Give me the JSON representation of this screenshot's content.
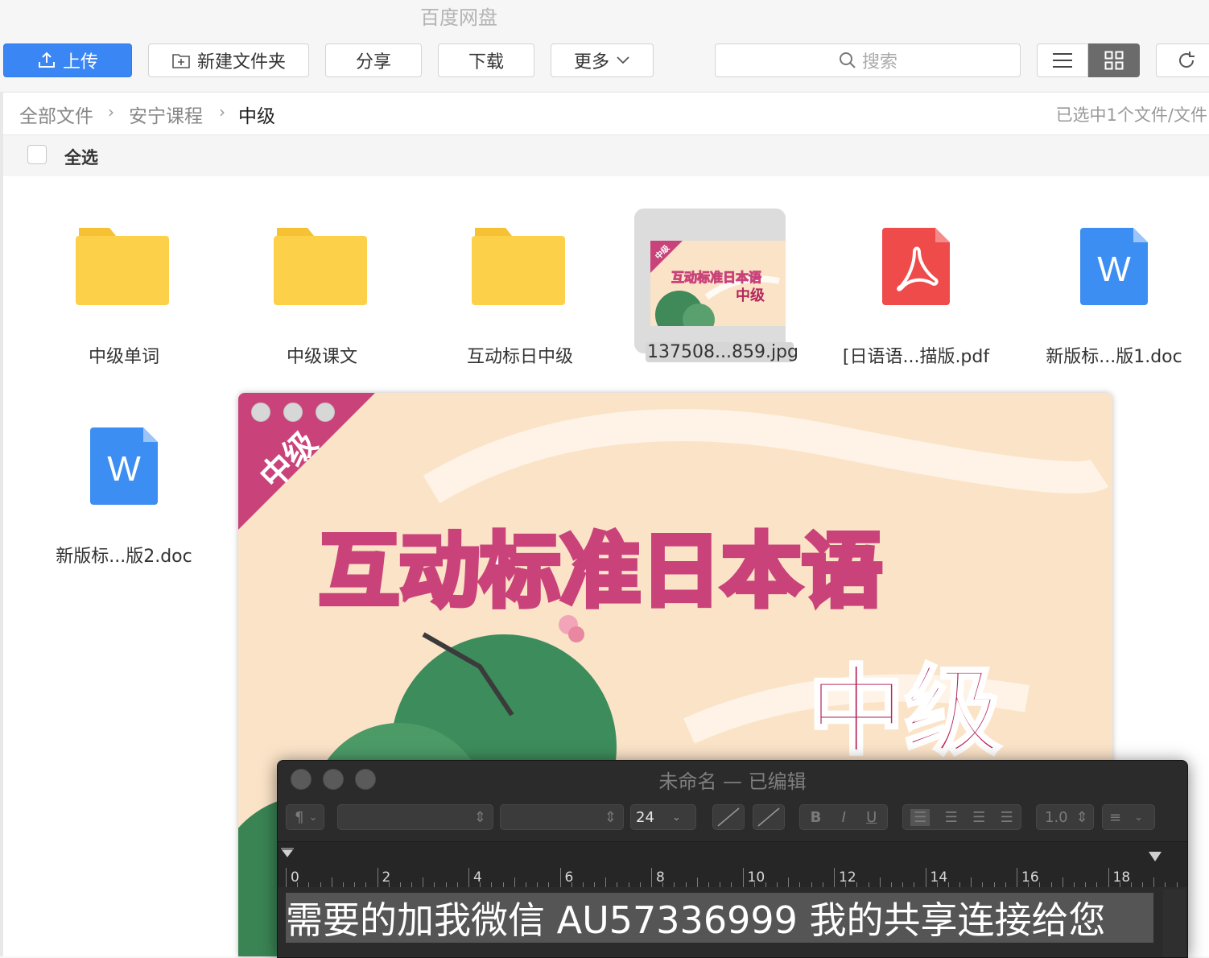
{
  "app": {
    "title": "百度网盘"
  },
  "toolbar": {
    "upload_label": "上传",
    "new_folder_label": "新建文件夹",
    "share_label": "分享",
    "download_label": "下载",
    "more_label": "更多",
    "search_placeholder": "搜索"
  },
  "breadcrumb": {
    "items": [
      "全部文件",
      "安宁课程",
      "中级"
    ],
    "selection_info": "已选中1个文件/文件"
  },
  "select_all_label": "全选",
  "files": [
    {
      "name": "中级单词",
      "type": "folder"
    },
    {
      "name": "中级课文",
      "type": "folder"
    },
    {
      "name": "互动标日中级",
      "type": "folder"
    },
    {
      "name": "137508...859.jpg",
      "type": "image",
      "selected": true
    },
    {
      "name": "[日语语...描版.pdf",
      "type": "pdf"
    },
    {
      "name": "新版标...版1.doc",
      "type": "doc"
    },
    {
      "name": "新版标...版2.doc",
      "type": "doc"
    }
  ],
  "thumbnail": {
    "badge": "中级",
    "title": "互动标准日本语",
    "subtitle": "中级"
  },
  "preview": {
    "badge": "中级",
    "title": "互动标准日本语",
    "subtitle": "中级",
    "colors": {
      "background": "#fbe3c8",
      "title_stroke": "#c9437a",
      "subtitle": "#b5265a"
    }
  },
  "editor": {
    "title": "未命名 — 已编辑",
    "paragraph_label": "¶",
    "font_size": "24",
    "bold_label": "B",
    "italic_label": "I",
    "underline_label": "U",
    "line_spacing": "1.0",
    "ruler_numbers": [
      "0",
      "2",
      "4",
      "6",
      "8",
      "10",
      "12",
      "14",
      "16",
      "18"
    ],
    "body_text": "需要的加我微信 AU57336999 我的共享连接给您"
  }
}
